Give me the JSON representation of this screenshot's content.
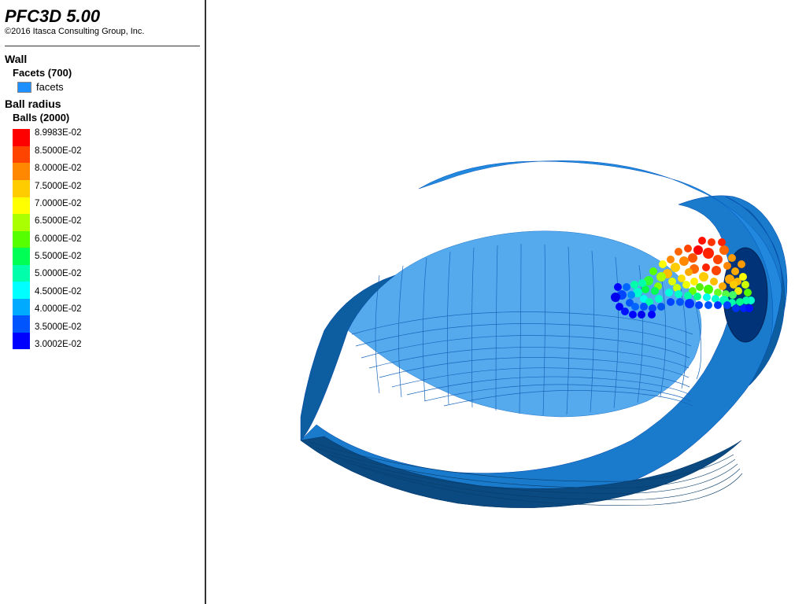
{
  "app": {
    "title": "PFC3D 5.00",
    "copyright": "©2016 Itasca Consulting Group, Inc."
  },
  "legend": {
    "wall_label": "Wall",
    "facets_label": "Facets (700)",
    "facets_item": "facets",
    "ball_radius_label": "Ball radius",
    "balls_label": "Balls (2000)",
    "color_scale": [
      {
        "value": "8.9983E-02",
        "color": "#ff0000"
      },
      {
        "value": "8.5000E-02",
        "color": "#ff4400"
      },
      {
        "value": "8.0000E-02",
        "color": "#ff8800"
      },
      {
        "value": "7.5000E-02",
        "color": "#ffcc00"
      },
      {
        "value": "7.0000E-02",
        "color": "#ffff00"
      },
      {
        "value": "6.5000E-02",
        "color": "#aaff00"
      },
      {
        "value": "6.0000E-02",
        "color": "#55ff00"
      },
      {
        "value": "5.5000E-02",
        "color": "#00ff55"
      },
      {
        "value": "5.0000E-02",
        "color": "#00ffaa"
      },
      {
        "value": "4.5000E-02",
        "color": "#00ffff"
      },
      {
        "value": "4.0000E-02",
        "color": "#00aaff"
      },
      {
        "value": "3.5000E-02",
        "color": "#0055ff"
      },
      {
        "value": "3.0002E-02",
        "color": "#0000ff"
      }
    ]
  }
}
